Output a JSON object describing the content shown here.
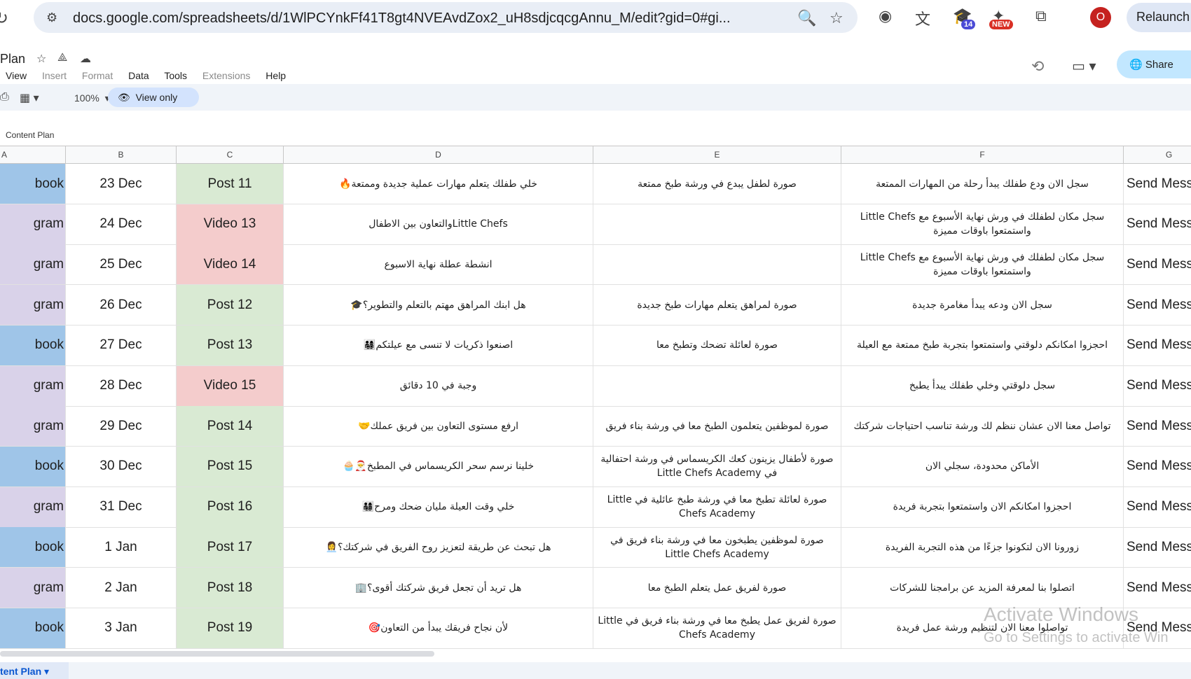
{
  "browser": {
    "url": "docs.google.com/spreadsheets/d/1WlPCYnkFf41T8gt4NVEAvdZox2_uH8sdjcqcgAnnu_M/edit?gid=0#gi...",
    "ext_badge_count": "14",
    "ext_badge_new": "NEW",
    "profile_initial": "O",
    "relaunch_label": "Relaunch"
  },
  "sheet_header": {
    "title": "Plan",
    "menu": [
      "View",
      "Insert",
      "Format",
      "Data",
      "Tools",
      "Extensions",
      "Help"
    ],
    "share_label": "Share"
  },
  "toolbar": {
    "zoom": "100%",
    "view_only_label": "View only"
  },
  "namebox": "Content Plan",
  "columns": [
    "A",
    "B",
    "C",
    "D",
    "E",
    "F",
    "G"
  ],
  "rows": [
    {
      "platform": "book",
      "date": "23 Dec",
      "type": "Post 11",
      "caption": "خلي طفلك يتعلم مهارات عملية جديدة وممتعة🔥",
      "visual": "صورة لطفل يبدع في ورشة طبخ ممتعة",
      "cta": "سجل الان ودع طفلك يبدأ رحلة من المهارات الممتعة",
      "action": "Send Mess"
    },
    {
      "platform": "gram",
      "date": "24 Dec",
      "type": "Video 13",
      "caption": "Little Chefsوالتعاون بين الاطفال",
      "visual": "",
      "cta": "سجل مكان لطفلك في ورش نهاية الأسبوع مع Little Chefs واستمتعوا باوقات مميزة",
      "action": "Send Mess"
    },
    {
      "platform": "gram",
      "date": "25 Dec",
      "type": "Video 14",
      "caption": "انشطة عطلة نهاية الاسبوع",
      "visual": "",
      "cta": "سجل مكان لطفلك في ورش نهاية الأسبوع مع Little Chefs واستمتعوا باوقات مميزة",
      "action": "Send Mess"
    },
    {
      "platform": "gram",
      "date": "26 Dec",
      "type": "Post 12",
      "caption": "هل ابنك المراهق مهتم بالتعلم والتطوير؟🎓",
      "visual": "صورة لمراهق يتعلم مهارات طبخ جديدة",
      "cta": "سجل الان ودعه يبدأ مغامرة جديدة",
      "action": "Send Mess"
    },
    {
      "platform": "book",
      "date": "27 Dec",
      "type": "Post 13",
      "caption": "اصنعوا ذكريات لا تنسى مع عيلتكم👨‍👩‍👧‍👦",
      "visual": "صورة لعائلة تضحك وتطبخ معا",
      "cta": "احجزوا امكانكم دلوقتي واستمتعوا بتجربة طبخ ممتعة مع العيلة",
      "action": "Send Mess"
    },
    {
      "platform": "gram",
      "date": "28 Dec",
      "type": "Video 15",
      "caption": "وجبة في 10 دقائق",
      "visual": "",
      "cta": "سجل دلوقتي وخلي طفلك يبدأ يطبخ",
      "action": "Send Mess"
    },
    {
      "platform": "gram",
      "date": "29 Dec",
      "type": "Post 14",
      "caption": "ارفع مستوى التعاون بين فريق عملك🤝",
      "visual": "صورة لموظفين يتعلمون الطبخ معا في ورشة بناء فريق",
      "cta": "تواصل معنا الان عشان ننظم لك ورشة تناسب احتياجات شركتك",
      "action": "Send Mess"
    },
    {
      "platform": "book",
      "date": "30 Dec",
      "type": "Post 15",
      "caption": "خلينا نرسم سحر الكريسماس في المطبخ🎅🧁",
      "visual": "صورة لأطفال يزينون كعك الكريسماس في ورشة احتفالية في Little Chefs Academy",
      "cta": "الأماكن محدودة، سجلي الان",
      "action": "Send Mess"
    },
    {
      "platform": "gram",
      "date": "31 Dec",
      "type": "Post 16",
      "caption": "خلي وقت العيلة مليان ضحك ومرح👨‍👩‍👧‍👦",
      "visual": "صورة لعائلة تطبخ معا في ورشة طبخ عائلية في Little Chefs Academy",
      "cta": "احجزوا امكانكم الان واستمتعوا بتجربة فريدة",
      "action": "Send Mess"
    },
    {
      "platform": "book",
      "date": "1 Jan",
      "type": "Post 17",
      "caption": "هل تبحث عن طريقة لتعزيز روح الفريق في شركتك؟👩‍💼",
      "visual": "صورة لموظفين يطبخون معا في ورشة بناء فريق في Little Chefs Academy",
      "cta": "زورونا الان لتكونوا جزءًا من هذه التجربة الفريدة",
      "action": "Send Mess"
    },
    {
      "platform": "gram",
      "date": "2 Jan",
      "type": "Post 18",
      "caption": "هل تريد أن تجعل فريق شركتك أقوى؟🏢",
      "visual": "صورة لفريق عمل يتعلم الطبخ معا",
      "cta": "اتصلوا بنا لمعرفة المزيد عن برامجنا للشركات",
      "action": "Send Mess"
    },
    {
      "platform": "book",
      "date": "3 Jan",
      "type": "Post 19",
      "caption": "لأن نجاح فريقك يبدأ من التعاون🎯",
      "visual": "صورة لفريق عمل يطبخ معا في ورشة بناء فريق في Little Chefs Academy",
      "cta": "تواصلوا معنا الان لتنظيم ورشة عمل فريدة",
      "action": "Send Mess"
    }
  ],
  "sheet_tab": "tent Plan",
  "watermark": {
    "line1": "Activate Windows",
    "line2": "Go to Settings to activate Win"
  }
}
